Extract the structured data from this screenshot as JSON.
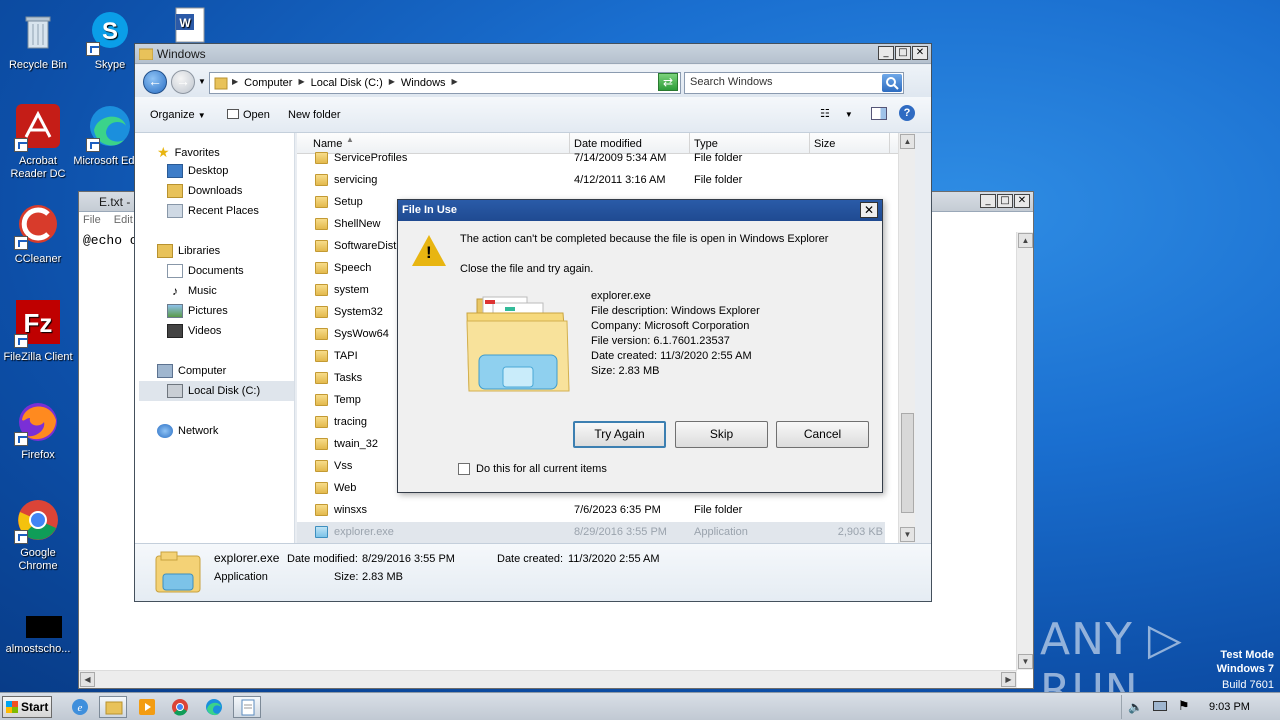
{
  "desktop_icons": [
    {
      "label": "Recycle Bin",
      "icon": "recycle-bin-icon"
    },
    {
      "label": "Skype",
      "icon": "skype-icon"
    },
    {
      "label": "Acrobat Reader DC",
      "icon": "acrobat-icon"
    },
    {
      "label": "Microsoft Edge",
      "icon": "edge-icon"
    },
    {
      "label": "CCleaner",
      "icon": "ccleaner-icon"
    },
    {
      "label": "FileZilla Client",
      "icon": "filezilla-icon"
    },
    {
      "label": "Firefox",
      "icon": "firefox-icon"
    },
    {
      "label": "Google Chrome",
      "icon": "chrome-icon"
    },
    {
      "label": "almostscho...",
      "icon": "black-file-icon"
    }
  ],
  "notepad": {
    "title": "E.txt -",
    "menu": [
      "File",
      "Edit"
    ],
    "text": "@echo o"
  },
  "explorer": {
    "title": "Windows",
    "address": [
      "Computer",
      "Local Disk (C:)",
      "Windows"
    ],
    "search_placeholder": "Search Windows",
    "toolbar": {
      "organize": "Organize",
      "open": "Open",
      "new_folder": "New folder"
    },
    "nav": {
      "favorites": "Favorites",
      "desktop": "Desktop",
      "downloads": "Downloads",
      "recent": "Recent Places",
      "libraries": "Libraries",
      "documents": "Documents",
      "music": "Music",
      "pictures": "Pictures",
      "videos": "Videos",
      "computer": "Computer",
      "local_disk": "Local Disk (C:)",
      "network": "Network"
    },
    "columns": {
      "name": "Name",
      "date": "Date modified",
      "type": "Type",
      "size": "Size"
    },
    "rows": [
      {
        "name": "ServiceProfiles",
        "date": "7/14/2009 5:34 AM",
        "type": "File folder",
        "size": ""
      },
      {
        "name": "servicing",
        "date": "4/12/2011 3:16 AM",
        "type": "File folder",
        "size": ""
      },
      {
        "name": "Setup",
        "date": "",
        "type": "",
        "size": ""
      },
      {
        "name": "ShellNew",
        "date": "",
        "type": "",
        "size": ""
      },
      {
        "name": "SoftwareDistri",
        "date": "",
        "type": "",
        "size": ""
      },
      {
        "name": "Speech",
        "date": "",
        "type": "",
        "size": ""
      },
      {
        "name": "system",
        "date": "",
        "type": "",
        "size": ""
      },
      {
        "name": "System32",
        "date": "",
        "type": "",
        "size": ""
      },
      {
        "name": "SysWow64",
        "date": "",
        "type": "",
        "size": ""
      },
      {
        "name": "TAPI",
        "date": "",
        "type": "",
        "size": ""
      },
      {
        "name": "Tasks",
        "date": "",
        "type": "",
        "size": ""
      },
      {
        "name": "Temp",
        "date": "",
        "type": "",
        "size": ""
      },
      {
        "name": "tracing",
        "date": "",
        "type": "",
        "size": ""
      },
      {
        "name": "twain_32",
        "date": "",
        "type": "",
        "size": ""
      },
      {
        "name": "Vss",
        "date": "",
        "type": "",
        "size": ""
      },
      {
        "name": "Web",
        "date": "",
        "type": "",
        "size": ""
      },
      {
        "name": "winsxs",
        "date": "7/6/2023 6:35 PM",
        "type": "File folder",
        "size": ""
      },
      {
        "name": "explorer.exe",
        "date": "8/29/2016 3:55 PM",
        "type": "Application",
        "size": "2,903 KB"
      }
    ],
    "details": {
      "name": "explorer.exe",
      "modified_label": "Date modified:",
      "modified": "8/29/2016 3:55 PM",
      "created_label": "Date created:",
      "created": "11/3/2020 2:55 AM",
      "type": "Application",
      "size_label": "Size:",
      "size": "2.83 MB"
    }
  },
  "dialog": {
    "title": "File In Use",
    "message": "The action can't be completed because the file is open in Windows Explorer",
    "instruction": "Close the file and try again.",
    "info": [
      "explorer.exe",
      "File description: Windows Explorer",
      "Company: Microsoft Corporation",
      "File version: 6.1.7601.23537",
      "Date created: 11/3/2020 2:55 AM",
      "Size: 2.83 MB"
    ],
    "buttons": {
      "try_again": "Try Again",
      "skip": "Skip",
      "cancel": "Cancel"
    },
    "checkbox": "Do this for all current items"
  },
  "taskbar": {
    "start": "Start",
    "clock": "9:03 PM"
  },
  "watermark": {
    "line1": "Test Mode",
    "line2": "Windows 7",
    "line3": "Build 7601",
    "brand": "ANY ▷ RUN"
  },
  "colors": {
    "dialog_title": "#1f4a91",
    "selection": "#e1e6ec",
    "warning": "#e8b511"
  }
}
